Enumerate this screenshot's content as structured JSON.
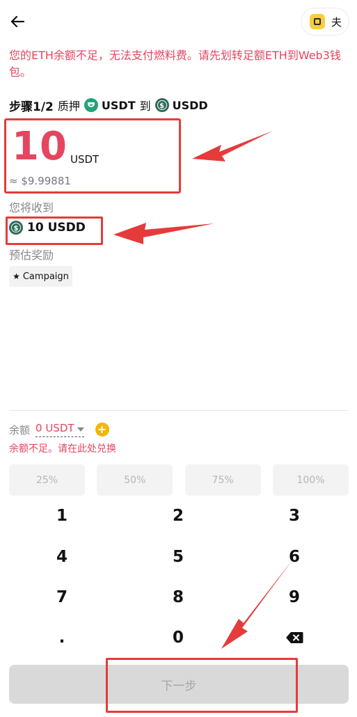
{
  "header": {
    "back_icon": "arrow-left-icon",
    "wallet_label": "夫",
    "wallet_icon": "wallet-icon"
  },
  "warning_text": "您的ETH余额不足，无法支付燃料费。请先划转足额ETH到Web3钱包。",
  "step": {
    "title": "步骤1/2",
    "action": "质押",
    "from_symbol": "USDT",
    "to_word": "到",
    "to_symbol": "USDD"
  },
  "amount": {
    "value": "10",
    "unit": "USDT",
    "usd_value": "≈ $9.99881"
  },
  "receive": {
    "label": "您将收到",
    "value": "10 USDD"
  },
  "reward": {
    "label": "预估奖励",
    "chip_label": "Campaign"
  },
  "balance": {
    "label": "余额",
    "value": "0 USDT",
    "insufficient_text": "余额不足。请在此处兑换"
  },
  "percent_buttons": [
    "25%",
    "50%",
    "75%",
    "100%"
  ],
  "keypad": {
    "k1": "1",
    "k2": "2",
    "k3": "3",
    "k4": "4",
    "k5": "5",
    "k6": "6",
    "k7": "7",
    "k8": "8",
    "k9": "9",
    "kdot": ".",
    "k0": "0"
  },
  "next_button_label": "下一步",
  "colors": {
    "accent_red": "#e64560",
    "highlight_box": "#e53b3b",
    "usdt_green": "#26a17b",
    "usdd_green": "#2d6b59",
    "add_yellow": "#f2b705"
  }
}
